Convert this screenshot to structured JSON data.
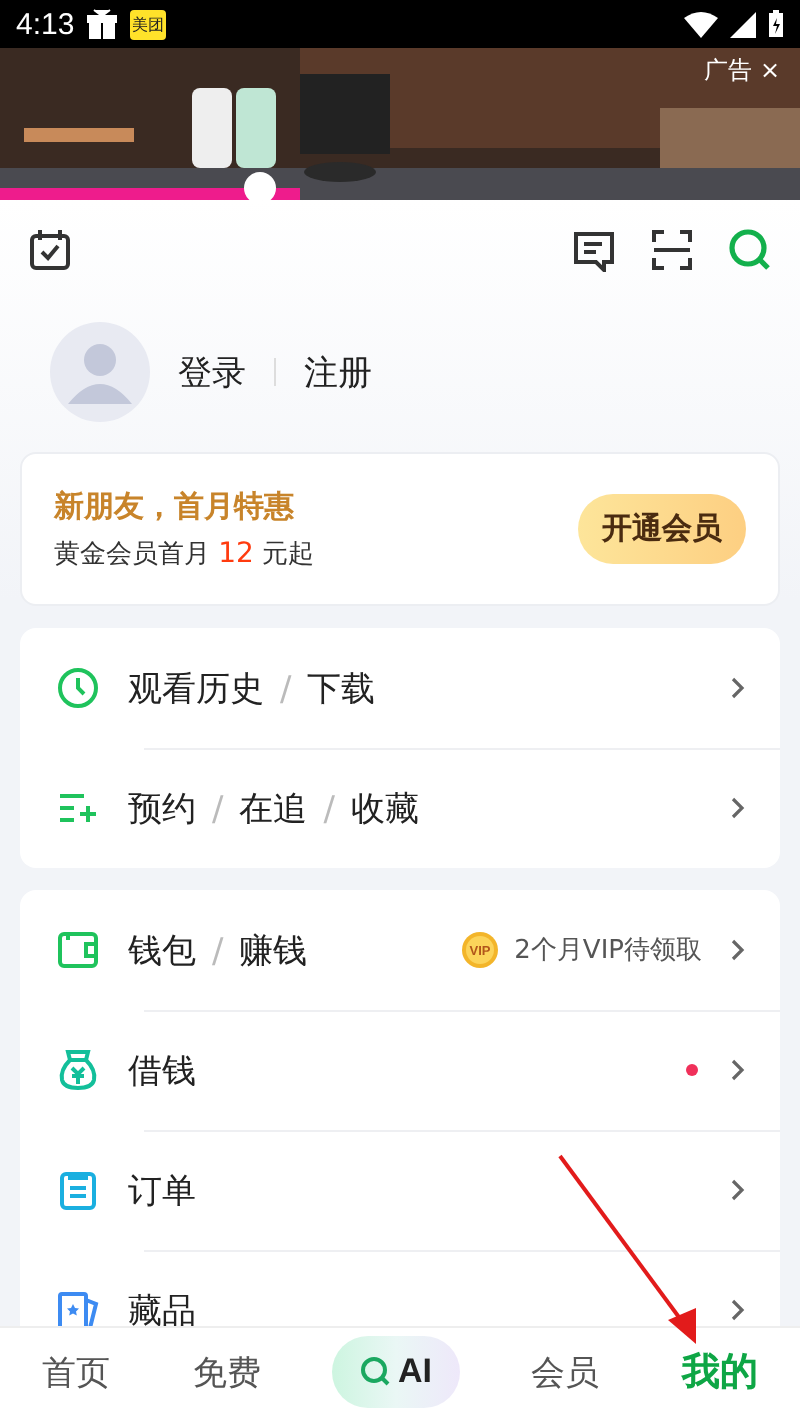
{
  "status_bar": {
    "time": "4:13",
    "app_badge": "美团"
  },
  "ad": {
    "label": "广告",
    "close": "×"
  },
  "profile": {
    "login": "登录",
    "register": "注册"
  },
  "promo": {
    "title": "新朋友，首月特惠",
    "subtitle_before": "黄金会员首月",
    "price": "12",
    "subtitle_after": "元起",
    "button": "开通会员"
  },
  "menu_groups": [
    {
      "items": [
        {
          "kind": "history",
          "labels": [
            "观看历史",
            "下载"
          ],
          "separator": "/"
        },
        {
          "kind": "follow",
          "labels": [
            "预约",
            "在追",
            "收藏"
          ],
          "separator": "/"
        }
      ]
    },
    {
      "items": [
        {
          "kind": "wallet",
          "labels": [
            "钱包",
            "赚钱"
          ],
          "separator": "/",
          "coin_label": "VIP",
          "extra": "2个月VIP待领取"
        },
        {
          "kind": "loan",
          "labels": [
            "借钱"
          ],
          "dot": true
        },
        {
          "kind": "order",
          "labels": [
            "订单"
          ]
        },
        {
          "kind": "collection",
          "labels": [
            "藏品"
          ]
        }
      ]
    }
  ],
  "bottom_nav": [
    {
      "kind": "text",
      "label": "首页",
      "selected": false
    },
    {
      "kind": "text",
      "label": "免费",
      "selected": false
    },
    {
      "kind": "ai",
      "label": "AI",
      "selected": false
    },
    {
      "kind": "text",
      "label": "会员",
      "selected": false
    },
    {
      "kind": "text",
      "label": "我的",
      "selected": true
    }
  ]
}
